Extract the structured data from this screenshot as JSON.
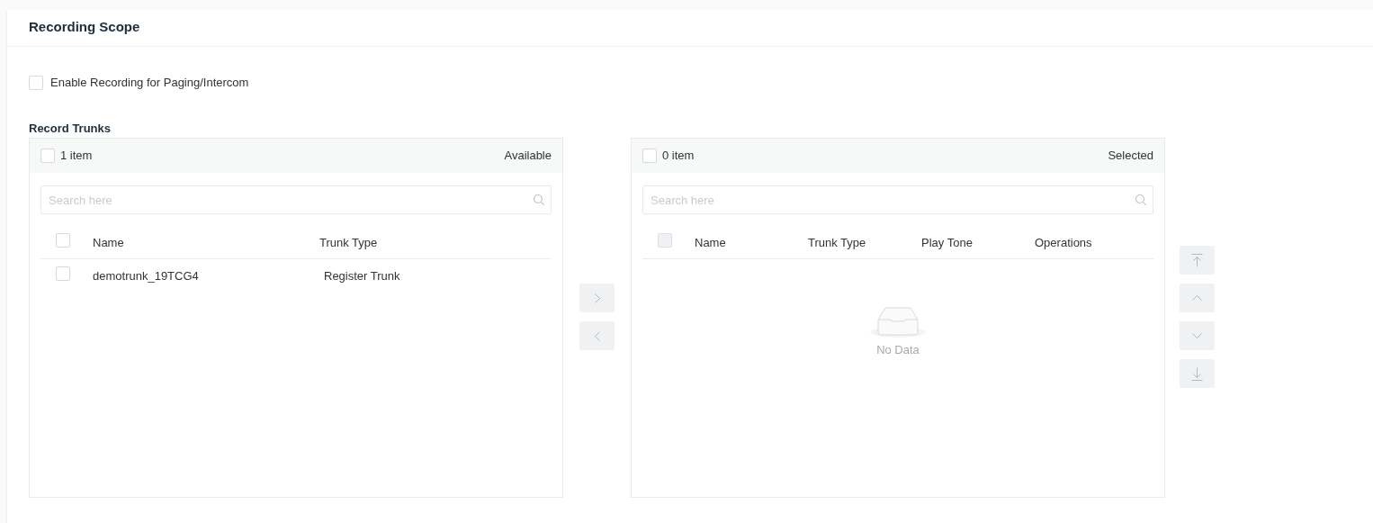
{
  "section": {
    "title": "Recording Scope"
  },
  "enable_recording": {
    "label": "Enable Recording for Paging/Intercom",
    "checked": false
  },
  "record_trunks": {
    "label": "Record Trunks",
    "available": {
      "count": "1 item",
      "title": "Available",
      "all_checked": false,
      "select_all_disabled": false,
      "search": {
        "placeholder": "Search here"
      },
      "columns": [
        "Name",
        "Trunk Type"
      ],
      "rows": [
        {
          "name": "demotrunk_19TCG4",
          "trunk_type": "Register Trunk",
          "checked": false
        }
      ]
    },
    "transfer_buttons": [
      {
        "kind": "right",
        "disabled": true
      },
      {
        "kind": "left",
        "disabled": true
      }
    ],
    "selected": {
      "count": "0 item",
      "title": "Selected",
      "all_checked": false,
      "select_all_disabled": true,
      "search": {
        "placeholder": "Search here"
      },
      "columns": [
        "Name",
        "Trunk Type",
        "Play Tone",
        "Operations"
      ],
      "empty_text": "No Data"
    },
    "sort_buttons": [
      {
        "kind": "top",
        "disabled": true
      },
      {
        "kind": "up",
        "disabled": true
      },
      {
        "kind": "down",
        "disabled": true
      },
      {
        "kind": "bottom",
        "disabled": true
      }
    ]
  }
}
